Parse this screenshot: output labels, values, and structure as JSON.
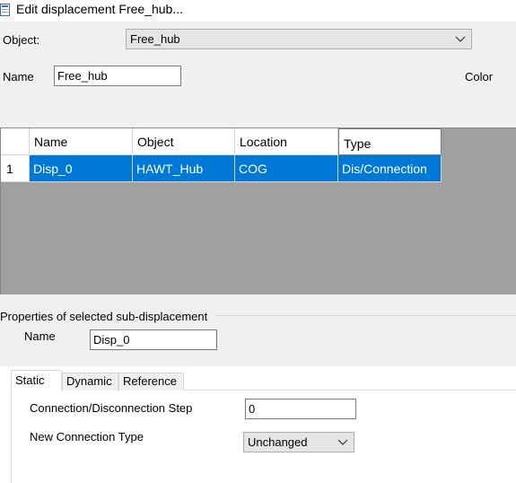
{
  "window": {
    "title": "Edit displacement Free_hub..."
  },
  "form": {
    "object_label": "Object:",
    "object_value": "Free_hub",
    "name_label": "Name",
    "name_value": "Free_hub",
    "color_label": "Color"
  },
  "grid": {
    "columns": [
      "Name",
      "Object",
      "Location",
      "Type"
    ],
    "rows": [
      {
        "index": "1",
        "cells": [
          "Disp_0",
          "HAWT_Hub",
          "COG",
          "Dis/Connection"
        ]
      }
    ]
  },
  "properties": {
    "group_label": "Properties of selected sub-displacement",
    "name_label": "Name",
    "name_value": "Disp_0"
  },
  "tabs": [
    "Static",
    "Dynamic",
    "Reference"
  ],
  "static": {
    "step_label": "Connection/Disconnection Step",
    "step_value": "0",
    "type_label": "New Connection Type",
    "type_value": "Unchanged"
  }
}
